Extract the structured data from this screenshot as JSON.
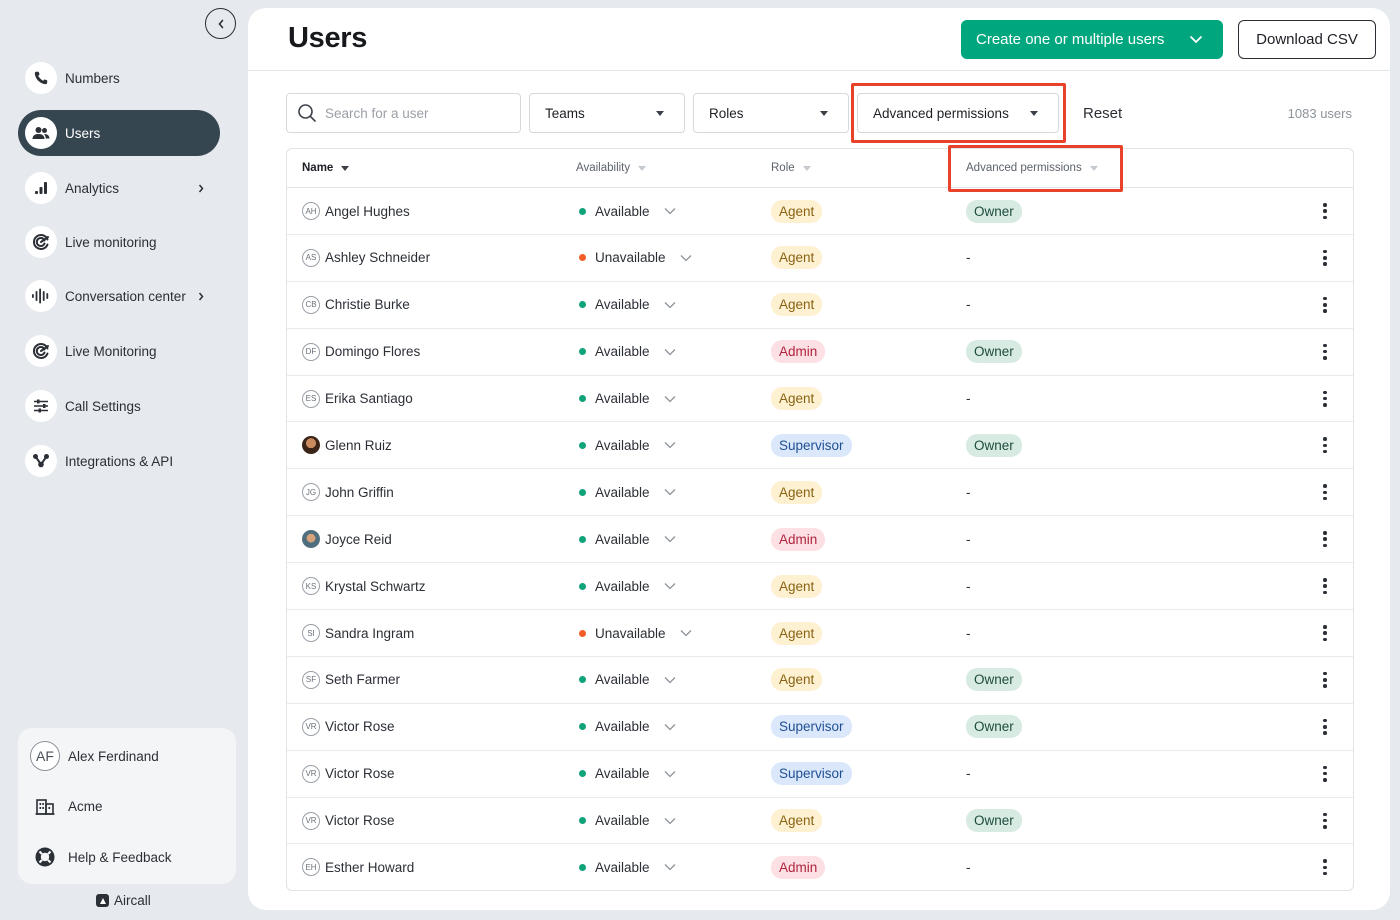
{
  "sidebar": {
    "items": [
      {
        "label": "Numbers",
        "icon": "phone-icon"
      },
      {
        "label": "Users",
        "icon": "users-icon"
      },
      {
        "label": "Analytics",
        "icon": "analytics-icon"
      },
      {
        "label": "Live monitoring",
        "icon": "live-monitoring-icon"
      },
      {
        "label": "Conversation center",
        "icon": "conversation-center-icon"
      },
      {
        "label": "Live Monitoring",
        "icon": "live-monitoring-icon"
      },
      {
        "label": "Call Settings",
        "icon": "sliders-icon"
      },
      {
        "label": "Integrations & API",
        "icon": "integrations-icon"
      }
    ],
    "account": {
      "user_initials": "AF",
      "user_name": "Alex Ferdinand",
      "company": "Acme",
      "help": "Help & Feedback"
    },
    "brand": "Aircall"
  },
  "header": {
    "title": "Users",
    "create_label": "Create one or multiple users",
    "download_label": "Download CSV"
  },
  "filters": {
    "search_placeholder": "Search for a user",
    "teams": "Teams",
    "roles": "Roles",
    "advanced": "Advanced permissions",
    "reset": "Reset",
    "count": "1083 users"
  },
  "table": {
    "columns": {
      "name": "Name",
      "availability": "Availability",
      "role": "Role",
      "advanced": "Advanced permissions"
    },
    "rows": [
      {
        "initials": "AH",
        "name": "Angel Hughes",
        "availability": "Available",
        "role": "Agent",
        "advanced": "Owner"
      },
      {
        "initials": "AS",
        "name": "Ashley Schneider",
        "availability": "Unavailable",
        "role": "Agent",
        "advanced": "-"
      },
      {
        "initials": "CB",
        "name": "Christie Burke",
        "availability": "Available",
        "role": "Agent",
        "advanced": "-"
      },
      {
        "initials": "DF",
        "name": "Domingo Flores",
        "availability": "Available",
        "role": "Admin",
        "advanced": "Owner"
      },
      {
        "initials": "ES",
        "name": "Erika Santiago",
        "availability": "Available",
        "role": "Agent",
        "advanced": "-"
      },
      {
        "initials": "",
        "name": "Glenn Ruiz",
        "availability": "Available",
        "role": "Supervisor",
        "advanced": "Owner"
      },
      {
        "initials": "JG",
        "name": "John Griffin",
        "availability": "Available",
        "role": "Agent",
        "advanced": "-"
      },
      {
        "initials": "",
        "name": "Joyce Reid",
        "availability": "Available",
        "role": "Admin",
        "advanced": "-"
      },
      {
        "initials": "KS",
        "name": "Krystal Schwartz",
        "availability": "Available",
        "role": "Agent",
        "advanced": "-"
      },
      {
        "initials": "SI",
        "name": "Sandra Ingram",
        "availability": "Unavailable",
        "role": "Agent",
        "advanced": "-"
      },
      {
        "initials": "SF",
        "name": "Seth Farmer",
        "availability": "Available",
        "role": "Agent",
        "advanced": "Owner"
      },
      {
        "initials": "VR",
        "name": "Victor Rose",
        "availability": "Available",
        "role": "Supervisor",
        "advanced": "Owner"
      },
      {
        "initials": "VR",
        "name": "Victor Rose",
        "availability": "Available",
        "role": "Supervisor",
        "advanced": "-"
      },
      {
        "initials": "VR",
        "name": "Victor Rose",
        "availability": "Available",
        "role": "Agent",
        "advanced": "Owner"
      },
      {
        "initials": "EH",
        "name": "Esther Howard",
        "availability": "Available",
        "role": "Admin",
        "advanced": "-"
      }
    ]
  },
  "colors": {
    "accent": "#00a77e",
    "highlight": "#e8432a",
    "active_nav": "#364651",
    "available": "#0fa37a",
    "unavailable": "#f25c2a",
    "agent_bg": "#fdf1d2",
    "agent_fg": "#8a6212",
    "admin_bg": "#fde0e4",
    "admin_fg": "#b0243e",
    "supervisor_bg": "#dbe8fb",
    "supervisor_fg": "#1f4f93",
    "owner_bg": "#d8ebe3",
    "owner_fg": "#1d4c3d"
  }
}
